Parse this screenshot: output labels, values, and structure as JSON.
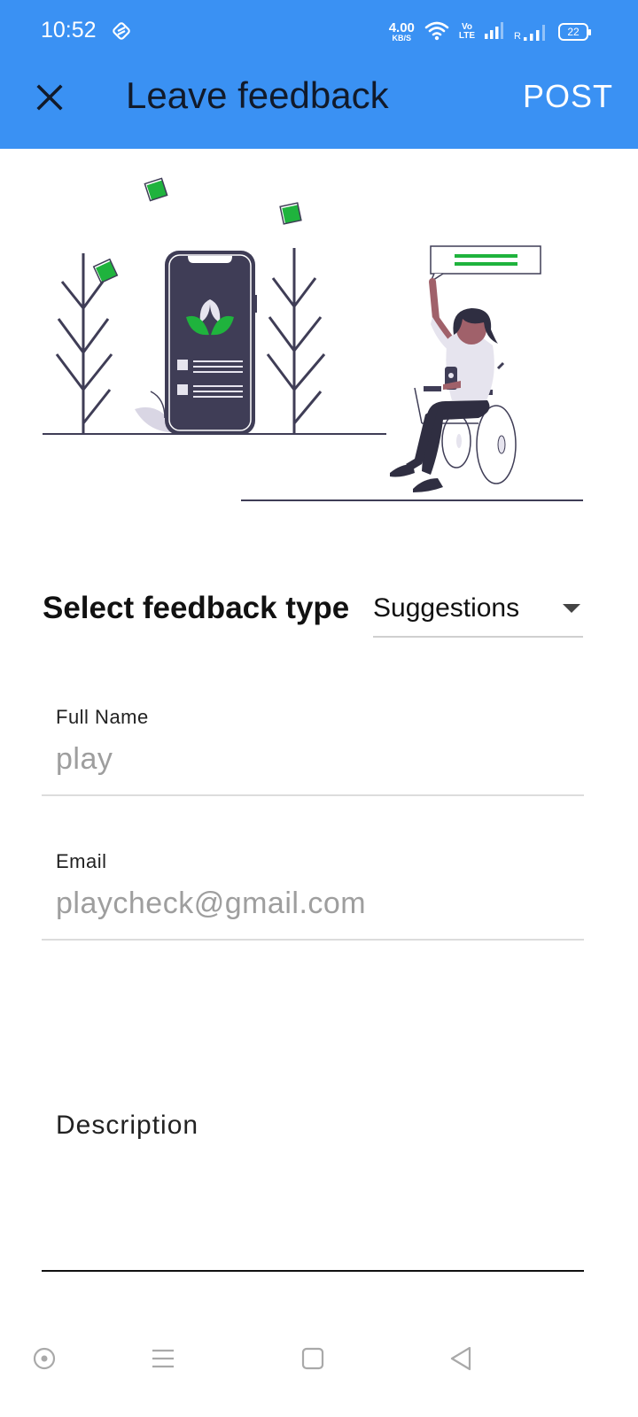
{
  "status_bar": {
    "time": "10:52",
    "net_speed_value": "4.00",
    "net_speed_unit": "KB/S",
    "volte_top": "Vo",
    "volte_bottom": "LTE",
    "roaming_label": "R",
    "battery": "22",
    "icons": [
      "sync-icon",
      "wifi-icon",
      "volte-icon",
      "signal-icon",
      "roaming-signal-icon",
      "battery-icon"
    ]
  },
  "app_bar": {
    "title": "Leave feedback",
    "close_icon": "close-icon",
    "post_label": "POST",
    "background_color": "#3a91f3",
    "title_color": "#111a2a"
  },
  "illustration": {
    "description_name": "feedback-illustration",
    "accent_color": "#1fb33d"
  },
  "form": {
    "feedback_type": {
      "label": "Select feedback type",
      "selected": "Suggestions",
      "dropdown_icon": "dropdown-arrow-icon"
    },
    "full_name": {
      "label": "Full Name",
      "value": "play"
    },
    "email": {
      "label": "Email",
      "value": "playcheck@gmail.com"
    },
    "description": {
      "label": "Description",
      "value": ""
    }
  },
  "nav_bar": {
    "items": [
      "assistant-icon",
      "menu-icon",
      "home-icon",
      "back-icon"
    ]
  }
}
